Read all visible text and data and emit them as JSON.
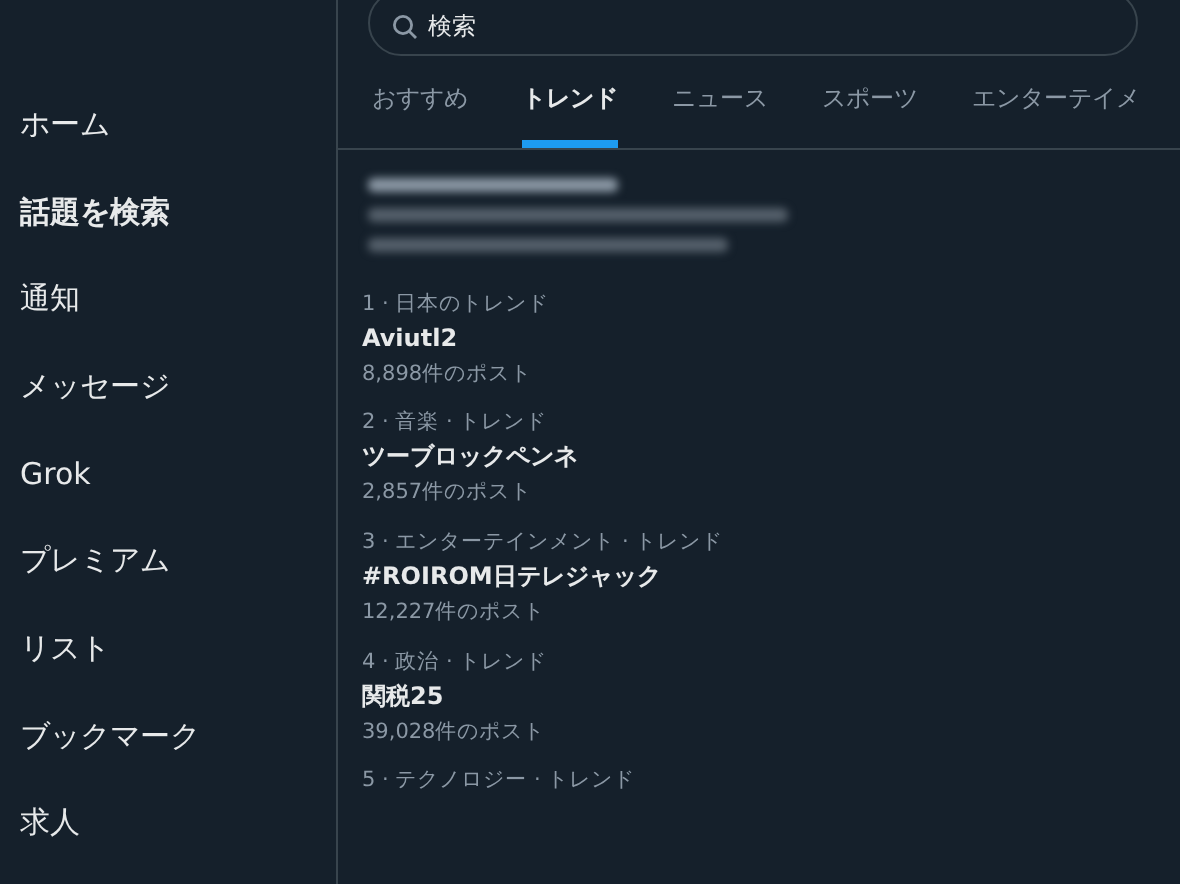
{
  "sidebar": {
    "items": [
      {
        "label": "ホーム",
        "selected": false
      },
      {
        "label": "話題を検索",
        "selected": true
      },
      {
        "label": "通知",
        "selected": false
      },
      {
        "label": "メッセージ",
        "selected": false
      },
      {
        "label": "Grok",
        "selected": false
      },
      {
        "label": "プレミアム",
        "selected": false
      },
      {
        "label": "リスト",
        "selected": false
      },
      {
        "label": "ブックマーク",
        "selected": false
      },
      {
        "label": "求人",
        "selected": false
      }
    ]
  },
  "search": {
    "value": "検索"
  },
  "tabs": [
    {
      "label": "おすすめ",
      "selected": false
    },
    {
      "label": "トレンド",
      "selected": true
    },
    {
      "label": "ニュース",
      "selected": false
    },
    {
      "label": "スポーツ",
      "selected": false
    },
    {
      "label": "エンターテイメ",
      "selected": false
    }
  ],
  "trends": [
    {
      "meta": "1 · 日本のトレンド",
      "title": "Aviutl2",
      "count": "8,898件のポスト"
    },
    {
      "meta": "2 · 音楽 · トレンド",
      "title": "ツーブロックペンネ",
      "count": "2,857件のポスト"
    },
    {
      "meta": "3 · エンターテインメント · トレンド",
      "title": "#ROIROM日テレジャック",
      "count": "12,227件のポスト"
    },
    {
      "meta": "4 · 政治 · トレンド",
      "title": "関税25",
      "count": "39,028件のポスト"
    },
    {
      "meta": "5 · テクノロジー · トレンド"
    }
  ]
}
